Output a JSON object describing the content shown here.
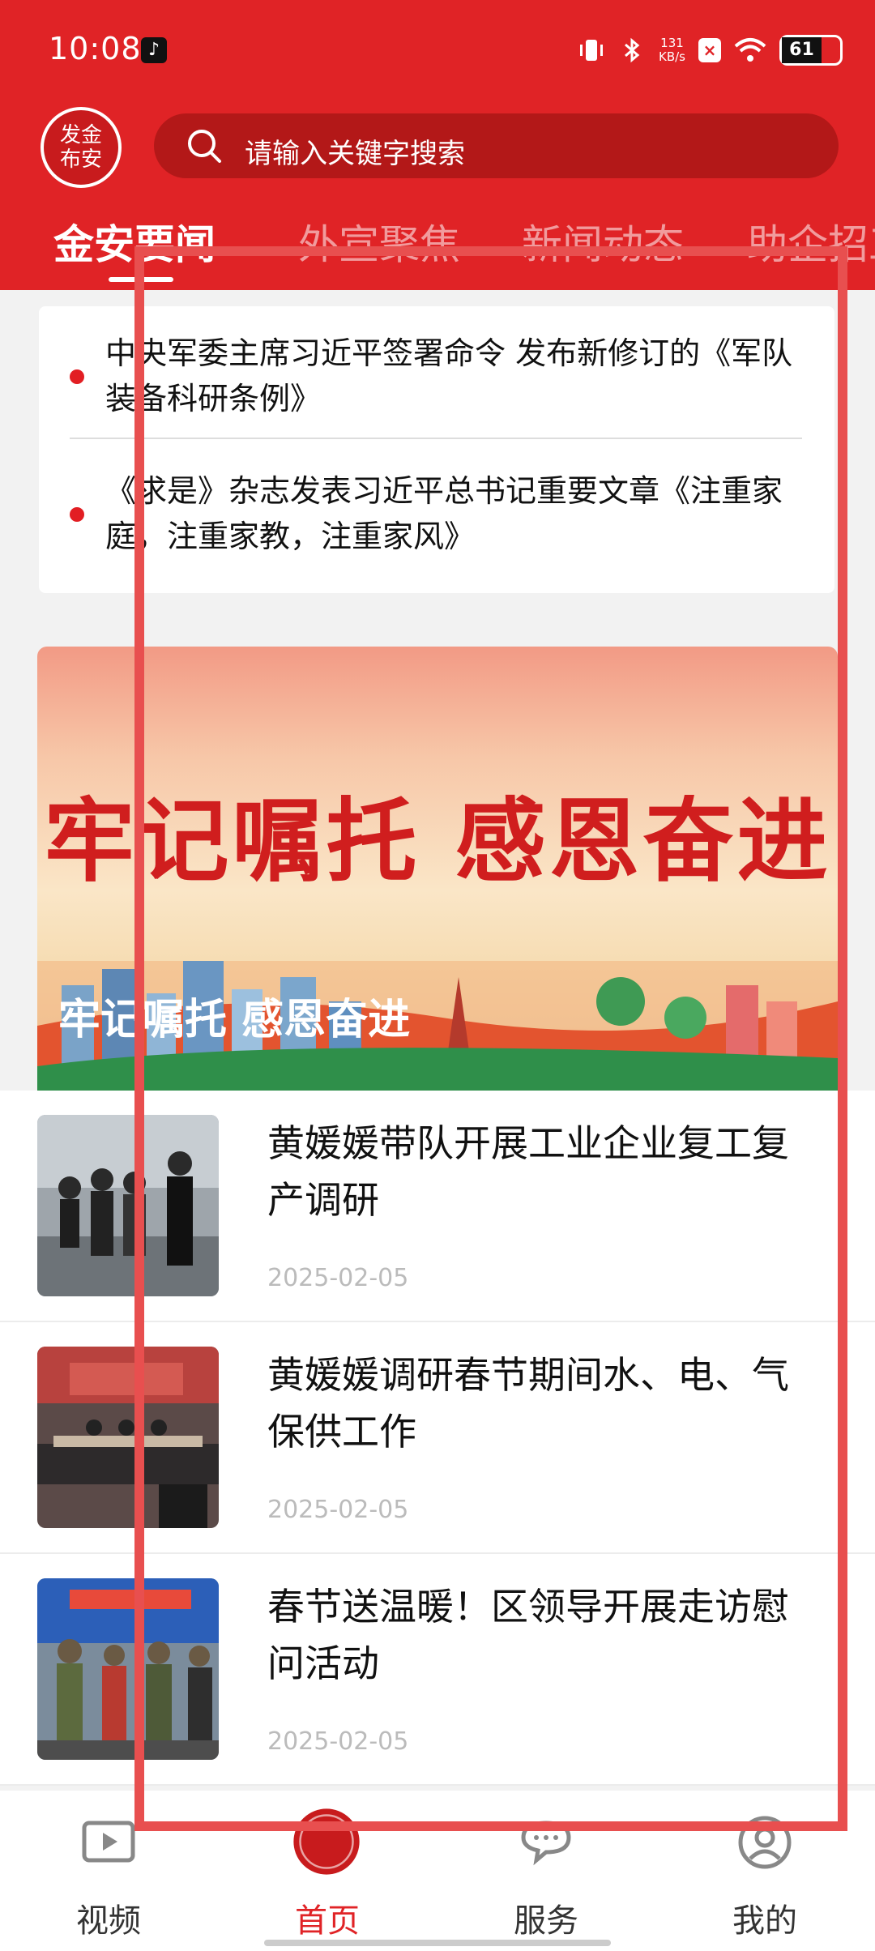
{
  "status_bar": {
    "time": "10:08",
    "net_speed_value": "131",
    "net_speed_unit": "KB/s",
    "battery": "61"
  },
  "header": {
    "logo_text": "发金布安",
    "search_placeholder": "请输入关键字搜索",
    "tabs": [
      "金安要闻",
      "外宣聚焦",
      "新闻动态",
      "助企招工"
    ],
    "active_tab_index": 0
  },
  "headlines": [
    "中央军委主席习近平签署命令 发布新修订的《军队装备科研条例》",
    "《求是》杂志发表习近平总书记重要文章《注重家庭，注重家教，注重家风》"
  ],
  "banner": {
    "headline": "牢记嘱托 感恩奋进",
    "caption": "牢记嘱托 感恩奋进"
  },
  "news": [
    {
      "title": "黄媛媛带队开展工业企业复工复产调研",
      "date": "2025-02-05"
    },
    {
      "title": "黄媛媛调研春节期间水、电、气保供工作",
      "date": "2025-02-05"
    },
    {
      "title": "春节送温暖！区领导开展走访慰问活动",
      "date": "2025-02-05"
    }
  ],
  "bottom_nav": [
    {
      "label": "视频",
      "icon": "video-icon"
    },
    {
      "label": "首页",
      "icon": "home-logo-icon"
    },
    {
      "label": "服务",
      "icon": "chat-bubbles-icon"
    },
    {
      "label": "我的",
      "icon": "user-icon"
    }
  ],
  "active_nav_index": 1,
  "colors": {
    "brand_red": "#e02326",
    "search_bg": "#b31818",
    "overlay_red": "#e84f4f",
    "date_gray": "#bbbbbb"
  }
}
